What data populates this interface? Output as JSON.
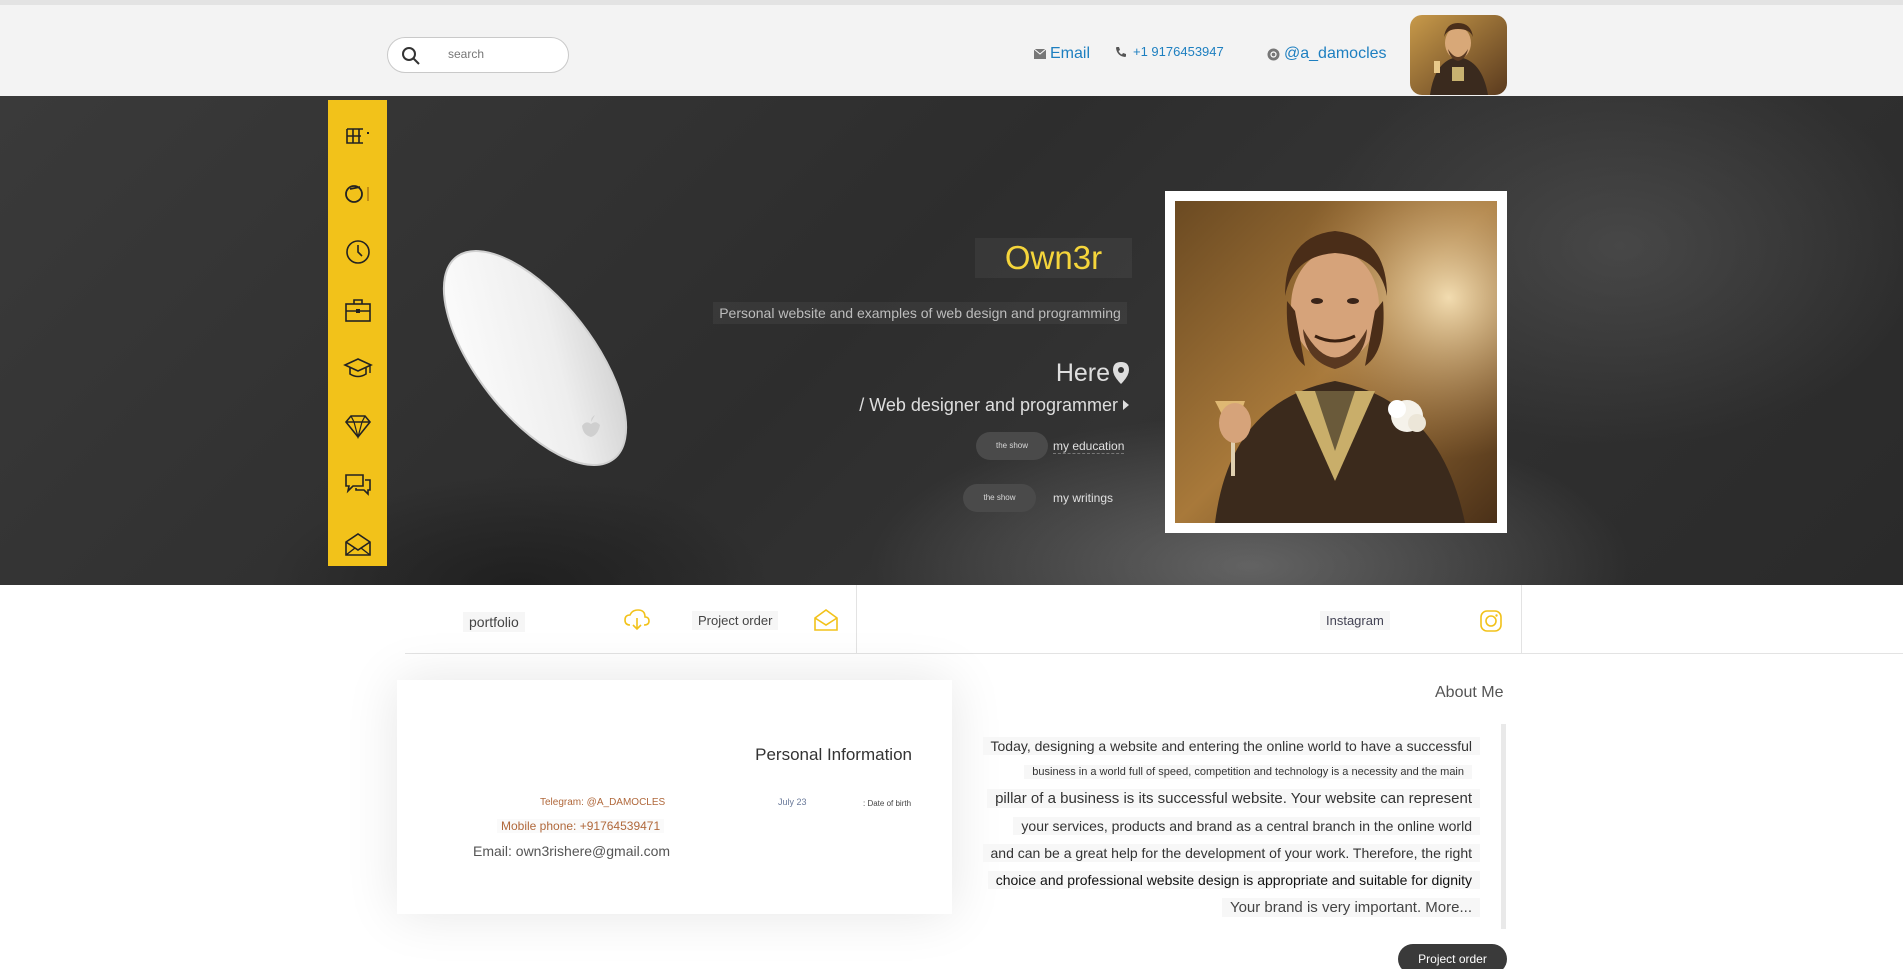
{
  "topbar": {
    "search_placeholder": "search",
    "email_label": "Email",
    "phone_label": "+1 9176453947",
    "instagram_label": "@a_damocles"
  },
  "hero": {
    "brand": "Own3r",
    "tagline": "Personal website and examples of web design and programming",
    "location": "Here",
    "role": "/ Web designer and programmer",
    "pills": [
      {
        "button": "the show",
        "label": "my education"
      },
      {
        "button": "the show",
        "label": "my writings"
      }
    ]
  },
  "sidebar": {
    "icons": [
      "menu-icon",
      "instagram-icon",
      "clock-icon",
      "briefcase-icon",
      "graduation-cap-icon",
      "diamond-icon",
      "chat-icon",
      "envelope-icon"
    ],
    "accent": "#f2c21a"
  },
  "tabs": {
    "portfolio": "portfolio",
    "project_order": "Project order",
    "instagram": "Instagram"
  },
  "personal": {
    "title": "Personal Information",
    "telegram": "Telegram: @A_DAMOCLES",
    "mobile": "Mobile phone: +91764539471",
    "email": "Email: own3rishere@gmail.com",
    "dob_value": "July 23",
    "dob_label": ": Date of birth"
  },
  "about": {
    "title": "About Me",
    "lines": [
      "Today, designing a website and entering the online world to have a successful",
      "business in a world full of speed, competition and technology is a necessity and the main",
      "pillar of a business is its successful website. Your website can represent",
      "your services, products and brand as a central branch in the online world",
      "and can be a great help for the development of your work. Therefore, the right",
      "choice and professional website design is appropriate and suitable for dignity",
      "Your brand is very important. More..."
    ],
    "button": "Project order"
  },
  "colors": {
    "accent_yellow": "#f2c21a",
    "link_blue": "#1d7fc0",
    "hero_bg": "#333333"
  }
}
